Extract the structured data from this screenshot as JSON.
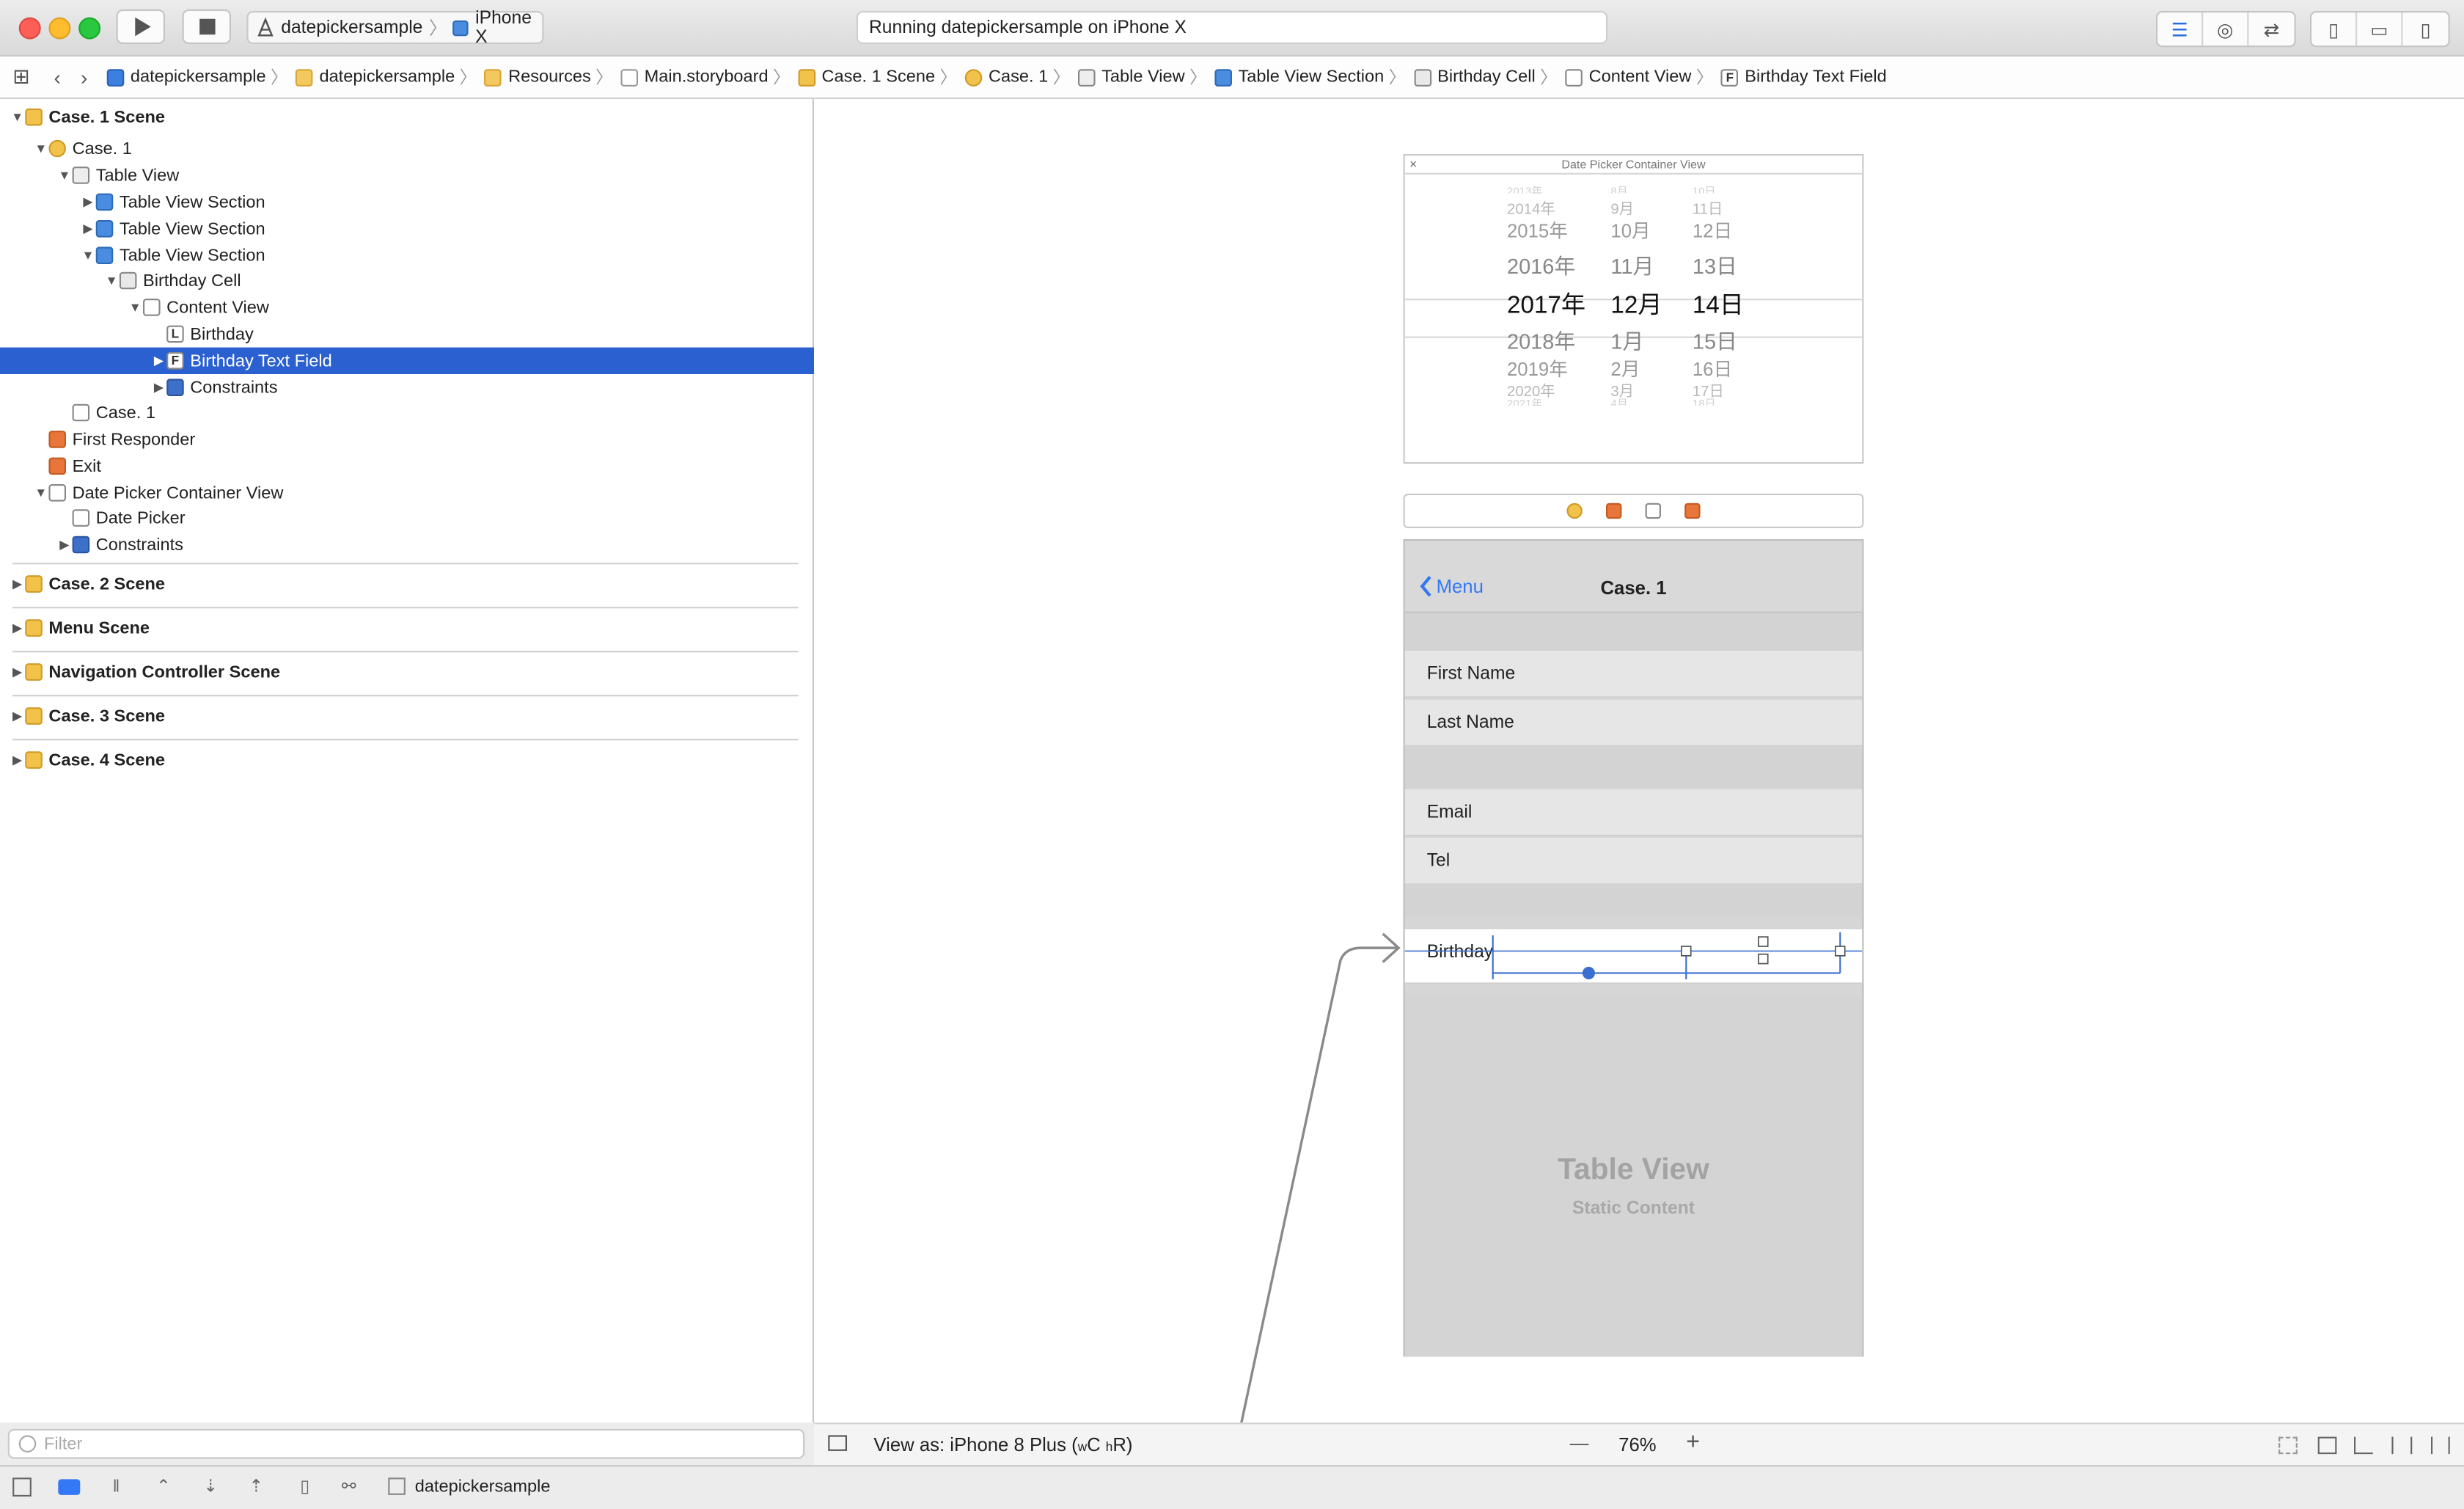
{
  "toolbar": {
    "run_icon": "play-icon",
    "stop_icon": "stop-icon",
    "scheme": "datepickersample",
    "device": "iPhone X",
    "status": "Running datepickersample on iPhone X"
  },
  "jumpbar": {
    "crumbs": [
      {
        "label": "datepickersample",
        "icon": "project-icon"
      },
      {
        "label": "datepickersample",
        "icon": "folder-icon"
      },
      {
        "label": "Resources",
        "icon": "folder-icon"
      },
      {
        "label": "Main.storyboard",
        "icon": "storyboard-file-icon"
      },
      {
        "label": "Case. 1 Scene",
        "icon": "scene-icon"
      },
      {
        "label": "Case. 1",
        "icon": "view-controller-icon"
      },
      {
        "label": "Table View",
        "icon": "table-view-icon"
      },
      {
        "label": "Table View Section",
        "icon": "cube-icon"
      },
      {
        "label": "Birthday Cell",
        "icon": "cell-icon"
      },
      {
        "label": "Content View",
        "icon": "view-icon"
      },
      {
        "label": "Birthday Text Field",
        "icon": "text-field-icon"
      }
    ]
  },
  "outline": {
    "rows": [
      {
        "label": "Case. 1 Scene"
      },
      {
        "label": "Case. 1"
      },
      {
        "label": "Table View"
      },
      {
        "label": "Table View Section"
      },
      {
        "label": "Table View Section"
      },
      {
        "label": "Table View Section"
      },
      {
        "label": "Birthday Cell"
      },
      {
        "label": "Content View"
      },
      {
        "label": "Birthday",
        "letter": "L"
      },
      {
        "label": "Birthday Text Field",
        "letter": "F"
      },
      {
        "label": "Constraints"
      },
      {
        "label": "Case. 1"
      },
      {
        "label": "First Responder"
      },
      {
        "label": "Exit"
      },
      {
        "label": "Date Picker Container View"
      },
      {
        "label": "Date Picker"
      },
      {
        "label": "Constraints"
      }
    ],
    "scenes": [
      {
        "label": "Case. 2 Scene"
      },
      {
        "label": "Menu Scene"
      },
      {
        "label": "Navigation Controller Scene"
      },
      {
        "label": "Case. 3 Scene"
      },
      {
        "label": "Case. 4 Scene"
      }
    ],
    "filter_placeholder": "Filter"
  },
  "canvas": {
    "date_picker_container": {
      "title": "Date Picker Container View",
      "close_glyph": "×",
      "rows": [
        {
          "year": "2013年",
          "month": "8月",
          "day": "10日"
        },
        {
          "year": "2014年",
          "month": "9月",
          "day": "11日"
        },
        {
          "year": "2015年",
          "month": "10月",
          "day": "12日"
        },
        {
          "year": "2016年",
          "month": "11月",
          "day": "13日"
        },
        {
          "year": "2017年",
          "month": "12月",
          "day": "14日"
        },
        {
          "year": "2018年",
          "month": "1月",
          "day": "15日"
        },
        {
          "year": "2019年",
          "month": "2月",
          "day": "16日"
        },
        {
          "year": "2020年",
          "month": "3月",
          "day": "17日"
        },
        {
          "year": "2021年",
          "month": "4月",
          "day": "18日"
        }
      ]
    },
    "phone": {
      "back_label": "Menu",
      "title": "Case. 1",
      "cells": [
        "First Name",
        "Last Name",
        "Email",
        "Tel"
      ],
      "birthday_label": "Birthday",
      "table_view_title": "Table View",
      "table_view_subtitle": "Static Content"
    },
    "bottom": {
      "view_as_prefix": "View as: iPhone 8 Plus (",
      "w_small": "w",
      "c_label": "C ",
      "h_small": "h",
      "r_label": "R)",
      "zoom_minus": "—",
      "zoom": "76%",
      "zoom_plus": "+"
    }
  },
  "footer": {
    "target": "datepickersample"
  },
  "colors": {
    "selection": "#2a60d0",
    "accent": "#3478f6",
    "close": "#fd5f57",
    "minimize": "#febc2e",
    "zoom": "#29c840"
  }
}
